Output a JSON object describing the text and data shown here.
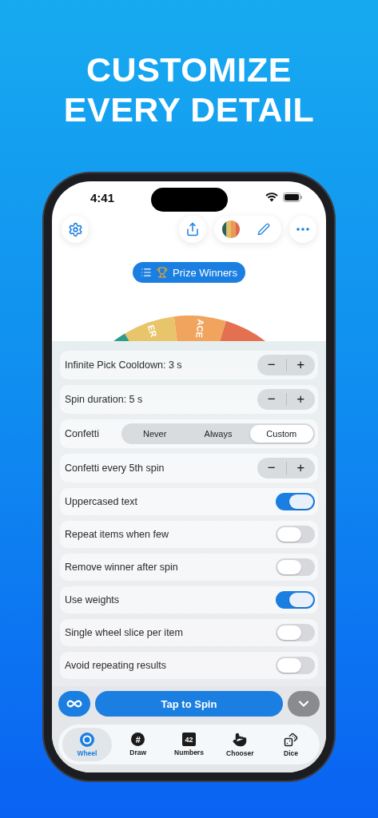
{
  "headline": [
    "CUSTOMIZE",
    "EVERY DETAIL"
  ],
  "status_bar": {
    "time": "4:41"
  },
  "wheel_title": {
    "label": "Prize Winners"
  },
  "wheel": {
    "slices": [
      {
        "color": "#2e9c8a"
      },
      {
        "label": "ER",
        "color": "#e8c46a"
      },
      {
        "label": "ACE",
        "color": "#f0a45e"
      },
      {
        "color": "#e4704f"
      }
    ]
  },
  "settings": [
    {
      "kind": "stepper",
      "label": "Infinite Pick Cooldown: 3 s",
      "minus": "−",
      "plus": "+"
    },
    {
      "kind": "stepper",
      "label": "Spin duration: 5 s",
      "minus": "−",
      "plus": "+"
    },
    {
      "kind": "segmented",
      "label": "Confetti",
      "options": [
        {
          "label": "Never",
          "selected": false
        },
        {
          "label": "Always",
          "selected": false
        },
        {
          "label": "Custom",
          "selected": true
        }
      ]
    },
    {
      "kind": "stepper",
      "label": "Confetti every 5th spin",
      "minus": "−",
      "plus": "+"
    },
    {
      "kind": "toggle",
      "label": "Uppercased text",
      "on": true
    },
    {
      "kind": "toggle",
      "label": "Repeat items when few",
      "on": false
    },
    {
      "kind": "toggle",
      "label": "Remove winner after spin",
      "on": false
    },
    {
      "kind": "toggle",
      "label": "Use weights",
      "on": true
    },
    {
      "kind": "toggle",
      "label": "Single wheel slice per item",
      "on": false
    },
    {
      "kind": "toggle",
      "label": "Avoid repeating results",
      "on": false
    }
  ],
  "spin_button": {
    "label": "Tap to Spin"
  },
  "tabs": [
    {
      "kind": "wheel",
      "label": "Wheel",
      "selected": true
    },
    {
      "kind": "draw",
      "label": "Draw",
      "icon_text": "#",
      "selected": false
    },
    {
      "kind": "numbers",
      "label": "Numbers",
      "icon_text": "42",
      "selected": false
    },
    {
      "kind": "chooser",
      "label": "Chooser",
      "selected": false
    },
    {
      "kind": "dice",
      "label": "Dice",
      "selected": false
    }
  ]
}
